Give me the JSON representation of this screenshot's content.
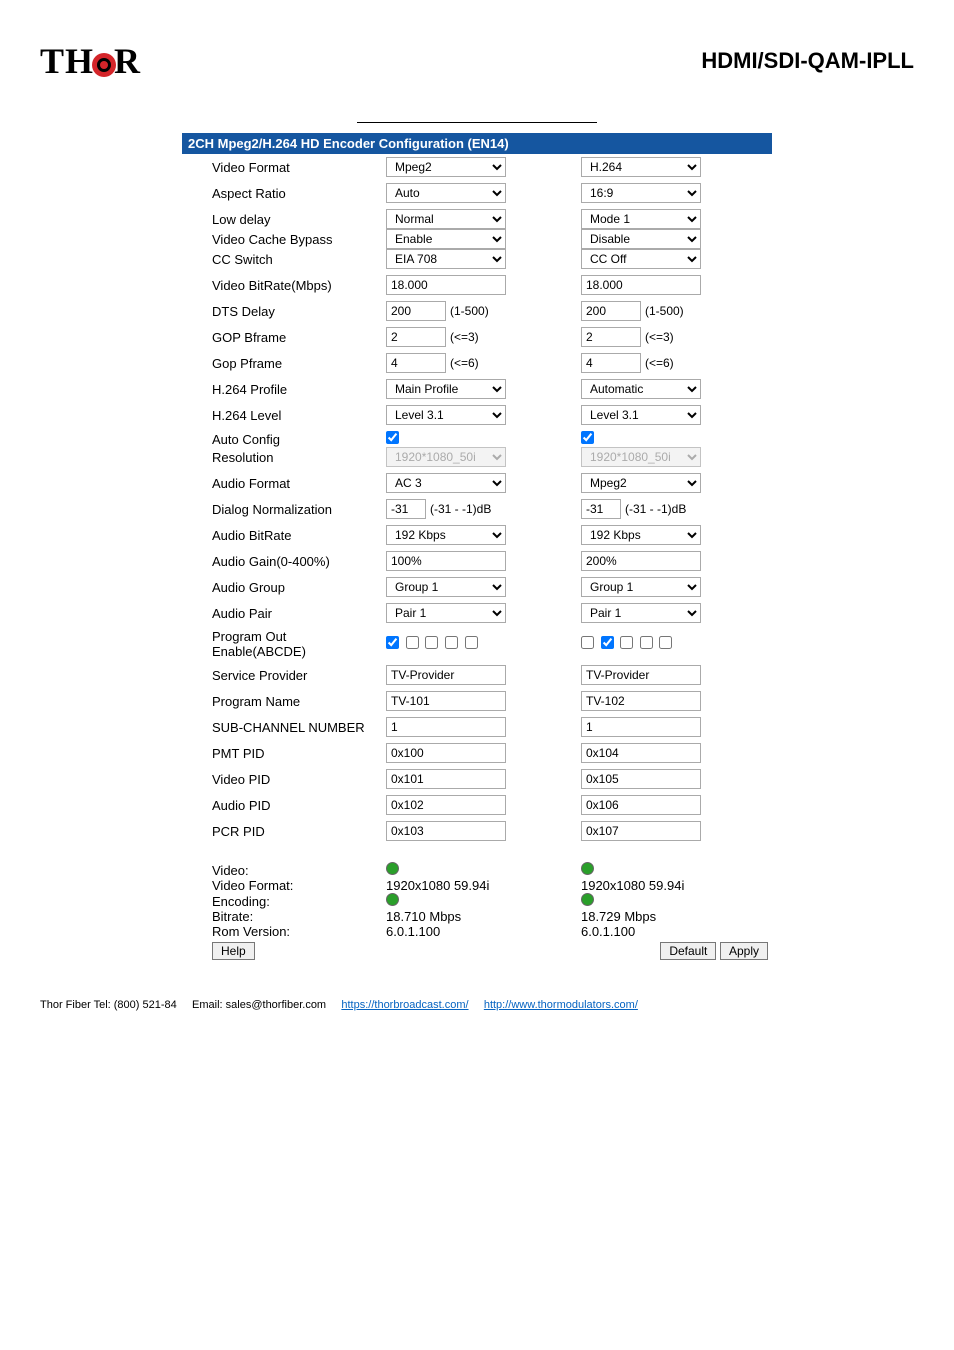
{
  "header": {
    "logo_left": "TH",
    "logo_right": "R",
    "title": "HDMI/SDI-QAM-IPLL"
  },
  "panel_title": "2CH Mpeg2/H.264 HD Encoder Configuration (EN14)",
  "rows": {
    "video_format": {
      "label": "Video Format",
      "c1": "Mpeg2",
      "c2": "H.264"
    },
    "aspect_ratio": {
      "label": "Aspect Ratio",
      "c1": "Auto",
      "c2": "16:9"
    },
    "low_delay": {
      "label": "Low delay",
      "c1": "Normal",
      "c2": "Mode 1"
    },
    "video_cache_bypass": {
      "label": "Video Cache Bypass",
      "c1": "Enable",
      "c2": "Disable"
    },
    "cc_switch": {
      "label": "CC Switch",
      "c1": "EIA 708",
      "c2": "CC Off"
    },
    "video_bitrate": {
      "label": "Video BitRate(Mbps)",
      "c1": "18.000",
      "c2": "18.000"
    },
    "dts_delay": {
      "label": "DTS Delay",
      "c1": "200",
      "c2": "200",
      "suffix": "(1-500)"
    },
    "gop_bframe": {
      "label": "GOP Bframe",
      "c1": "2",
      "c2": "2",
      "suffix": "(<=3)"
    },
    "gop_pframe": {
      "label": "Gop Pframe",
      "c1": "4",
      "c2": "4",
      "suffix": "(<=6)"
    },
    "h264_profile": {
      "label": "H.264 Profile",
      "c1": "Main Profile",
      "c2": "Automatic"
    },
    "h264_level": {
      "label": "H.264 Level",
      "c1": "Level 3.1",
      "c2": "Level 3.1"
    },
    "auto_config": {
      "label": "Auto Config"
    },
    "resolution": {
      "label": "Resolution",
      "c1": "1920*1080_50i",
      "c2": "1920*1080_50i"
    },
    "audio_format": {
      "label": "Audio Format",
      "c1": "AC 3",
      "c2": "Mpeg2"
    },
    "dialog_norm": {
      "label": "Dialog Normalization",
      "c1": "-31",
      "c2": "-31",
      "suffix": "(-31 - -1)dB"
    },
    "audio_bitrate": {
      "label": "Audio BitRate",
      "c1": "192 Kbps",
      "c2": "192 Kbps"
    },
    "audio_gain": {
      "label": "Audio Gain(0-400%)",
      "c1": "100%",
      "c2": "200%"
    },
    "audio_group": {
      "label": "Audio Group",
      "c1": "Group 1",
      "c2": "Group 1"
    },
    "audio_pair": {
      "label": "Audio Pair",
      "c1": "Pair 1",
      "c2": "Pair 1"
    },
    "program_out": {
      "label": "Program Out Enable(ABCDE)"
    },
    "service_provider": {
      "label": "Service Provider",
      "c1": "TV-Provider",
      "c2": "TV-Provider"
    },
    "program_name": {
      "label": "Program Name",
      "c1": "TV-101",
      "c2": "TV-102"
    },
    "sub_channel": {
      "label": "SUB-CHANNEL NUMBER",
      "c1": "1",
      "c2": "1"
    },
    "pmt_pid": {
      "label": "PMT PID",
      "c1": "0x100",
      "c2": "0x104"
    },
    "video_pid": {
      "label": "Video PID",
      "c1": "0x101",
      "c2": "0x105"
    },
    "audio_pid": {
      "label": "Audio PID",
      "c1": "0x102",
      "c2": "0x106"
    },
    "pcr_pid": {
      "label": "PCR PID",
      "c1": "0x103",
      "c2": "0x107"
    }
  },
  "status": {
    "video_label": "Video:",
    "video_format_label": "Video Format:",
    "video_format_c1": "1920x1080 59.94i",
    "video_format_c2": "1920x1080 59.94i",
    "encoding_label": "Encoding:",
    "bitrate_label": "Bitrate:",
    "bitrate_c1": "18.710 Mbps",
    "bitrate_c2": "18.729 Mbps",
    "rom_label": "Rom Version:",
    "rom_c1": "6.0.1.100",
    "rom_c2": "6.0.1.100"
  },
  "buttons": {
    "help": "Help",
    "default": "Default",
    "apply": "Apply"
  },
  "footer": {
    "tel": "Thor Fiber Tel: (800) 521-84",
    "email_label": "Email: sales@thorfiber.com",
    "link1": "https://thorbroadcast.com/",
    "link2": "http://www.thormodulators.com/"
  }
}
